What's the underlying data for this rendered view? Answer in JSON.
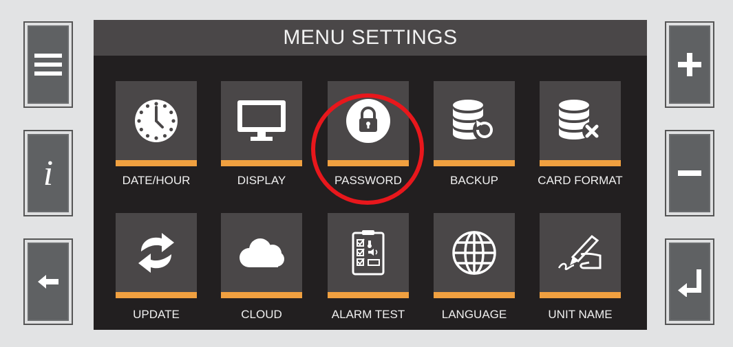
{
  "screen": {
    "title": "MENU SETTINGS"
  },
  "side_buttons": {
    "menu_icon": "hamburger-menu-icon",
    "info_label": "i",
    "back_icon": "arrow-left-icon",
    "plus_icon": "plus-icon",
    "minus_icon": "minus-icon",
    "enter_icon": "enter-return-icon"
  },
  "tiles": [
    {
      "label": "DATE/HOUR",
      "icon": "clock-icon"
    },
    {
      "label": "DISPLAY",
      "icon": "monitor-icon"
    },
    {
      "label": "PASSWORD",
      "icon": "lock-icon"
    },
    {
      "label": "BACKUP",
      "icon": "database-restore-icon"
    },
    {
      "label": "CARD FORMAT",
      "icon": "database-delete-icon"
    },
    {
      "label": "UPDATE",
      "icon": "sync-arrows-icon"
    },
    {
      "label": "CLOUD",
      "icon": "cloud-icon"
    },
    {
      "label": "ALARM TEST",
      "icon": "checklist-icon"
    },
    {
      "label": "LANGUAGE",
      "icon": "globe-icon"
    },
    {
      "label": "UNIT NAME",
      "icon": "signature-pen-icon"
    }
  ],
  "colors": {
    "accent": "#f0a040",
    "highlight_ring": "#e8171c",
    "screen_bg": "#221f20",
    "tile_bg": "#4a4748"
  }
}
